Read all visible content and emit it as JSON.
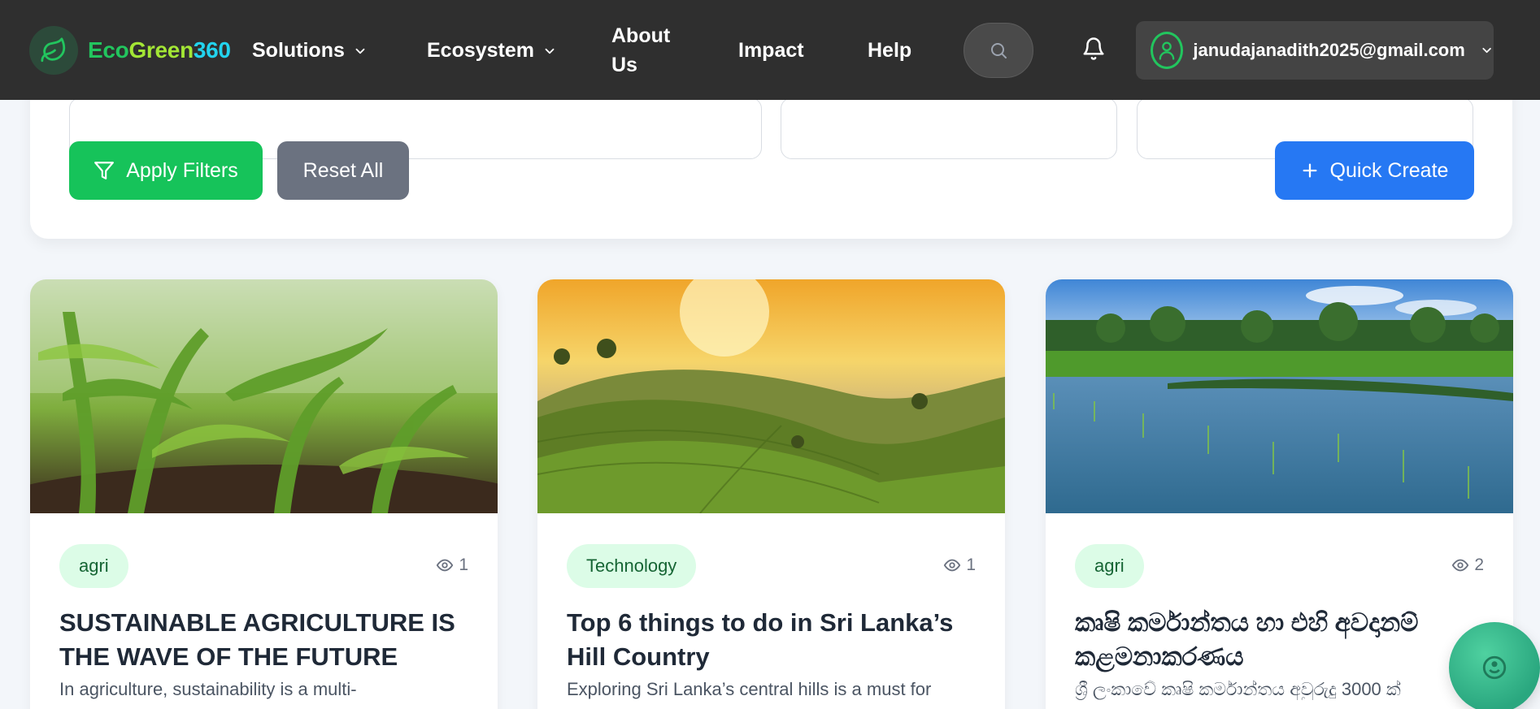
{
  "brand": {
    "part1": "Eco",
    "part2": "Green",
    "part3": "360"
  },
  "nav": {
    "solutions": "Solutions",
    "ecosystem": "Ecosystem",
    "about_line1": "About",
    "about_line2": "Us",
    "impact": "Impact",
    "help": "Help"
  },
  "user": {
    "email": "janudajanadith2025@gmail.com"
  },
  "filters": {
    "apply_label": "Apply Filters",
    "reset_label": "Reset All",
    "create_label": "Quick Create"
  },
  "colors": {
    "header_bg": "#2f2f2f",
    "apply": "#16c35a",
    "reset": "#6b7280",
    "create": "#2678f3",
    "tag_bg": "#dcfce7"
  },
  "cards": [
    {
      "tag": "agri",
      "views": "1",
      "title": "SUSTAINABLE AGRICULTURE IS THE WAVE OF THE FUTURE",
      "excerpt": "In agriculture, sustainability is a multi-",
      "image": "corn-seedlings"
    },
    {
      "tag": "Technology",
      "views": "1",
      "title": "Top 6 things to do in Sri Lanka’s Hill Country",
      "excerpt": "Exploring Sri Lanka’s central hills is a must for",
      "image": "tea-plantation-hills"
    },
    {
      "tag": "agri",
      "views": "2",
      "title": "කෘෂි කර්මාන්තය හා එහි අවදානම් කළමනාකරණය",
      "excerpt": "ශ්‍රී ලංකාවේ කෘෂි කර්මාන්තය අවුරුදු 3000 ක්",
      "image": "paddy-field"
    }
  ]
}
